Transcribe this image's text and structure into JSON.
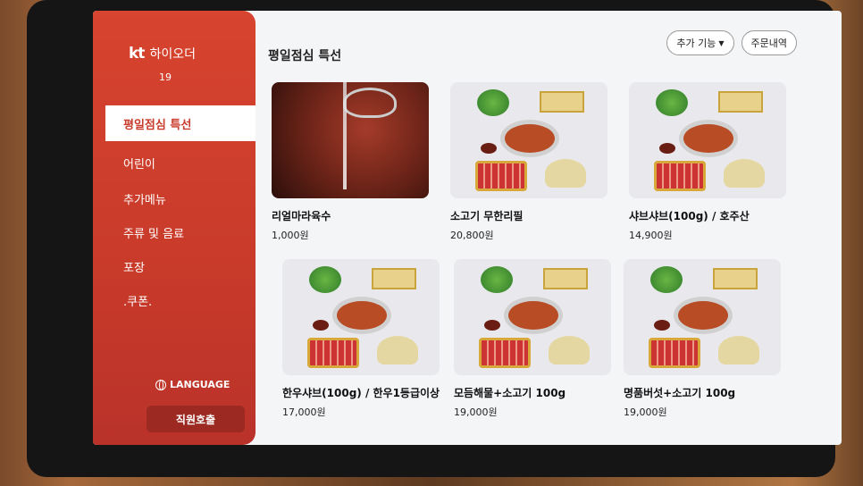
{
  "brand": {
    "logo": "kt",
    "name": "하이오더"
  },
  "table_number": "19",
  "sidebar": {
    "items": [
      {
        "label": "평일점심 특선",
        "active": true
      },
      {
        "label": "어린이",
        "active": false
      },
      {
        "label": "추가메뉴",
        "active": false
      },
      {
        "label": "주류 및 음료",
        "active": false
      },
      {
        "label": "포장",
        "active": false
      },
      {
        "label": ".쿠폰.",
        "active": false
      }
    ],
    "language_label": "LANGUAGE",
    "staff_call_label": "직원호출"
  },
  "header": {
    "title": "평일점심 특선",
    "more_features_label": "추가 기능",
    "order_history_label": "주문내역"
  },
  "menu": [
    {
      "name": "리얼마라육수",
      "price": "1,000원",
      "image": "pouring-broth"
    },
    {
      "name": "소고기 무한리필",
      "price": "20,800원",
      "image": "hotpot-set"
    },
    {
      "name": "샤브샤브(100g) / 호주산",
      "price": "14,900원",
      "image": "hotpot-set"
    },
    {
      "name": "한우샤브(100g) / 한우1등급이상",
      "price": "17,000원",
      "image": "hotpot-set"
    },
    {
      "name": "모듬해물+소고기 100g",
      "price": "19,000원",
      "image": "hotpot-seafood-set"
    },
    {
      "name": "명품버섯+소고기 100g",
      "price": "19,000원",
      "image": "hotpot-mushroom-set"
    }
  ],
  "colors": {
    "accent": "#c83a2a",
    "active_bg": "#ffffff",
    "screen_bg": "#f4f5f7"
  }
}
